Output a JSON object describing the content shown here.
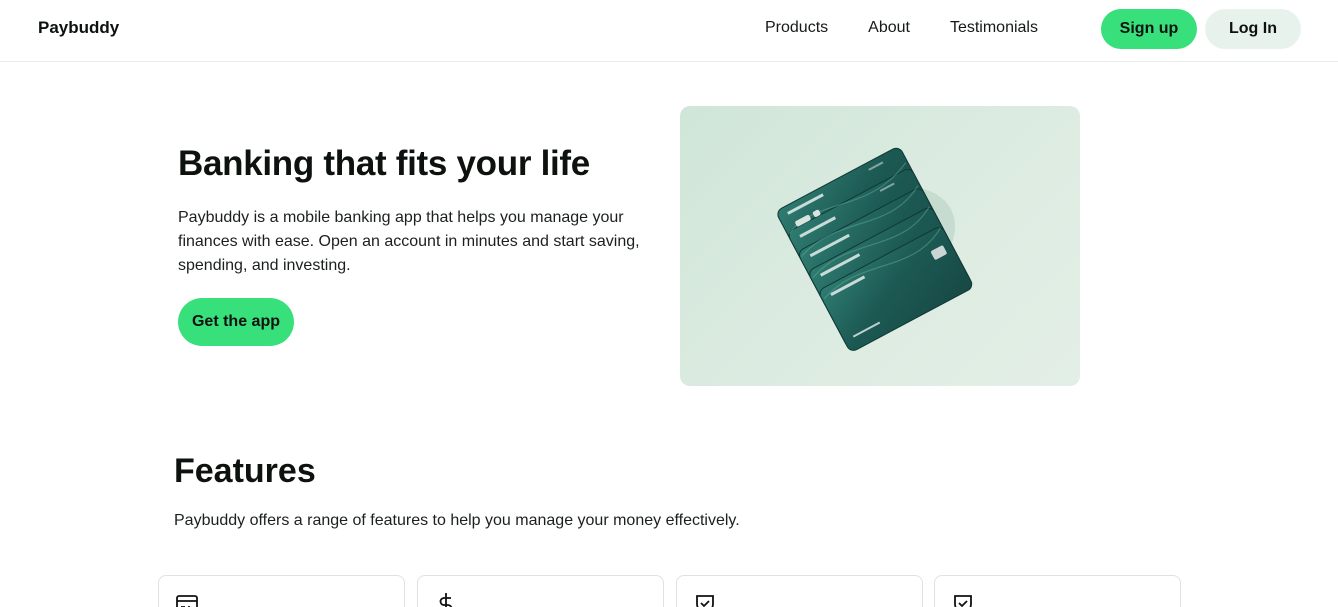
{
  "nav": {
    "brand": "Paybuddy",
    "links": [
      "Products",
      "About",
      "Testimonials"
    ],
    "signup_label": "Sign up",
    "login_label": "Log In"
  },
  "hero": {
    "title": "Banking that fits your life",
    "description": "Paybuddy is a mobile banking app that helps you manage your finances with ease. Open an account in minutes and start saving, spending, and investing.",
    "cta_label": "Get the app"
  },
  "features": {
    "title": "Features",
    "description": "Paybuddy offers a range of features to help you manage your money effectively.",
    "card_icons": [
      "credit-card-icon",
      "dollar-icon",
      "shield-check-icon",
      "shield-check-icon"
    ]
  },
  "colors": {
    "accent": "#38e07b",
    "secondary": "#e8f2ec",
    "card_teal": "#1f5e58"
  }
}
